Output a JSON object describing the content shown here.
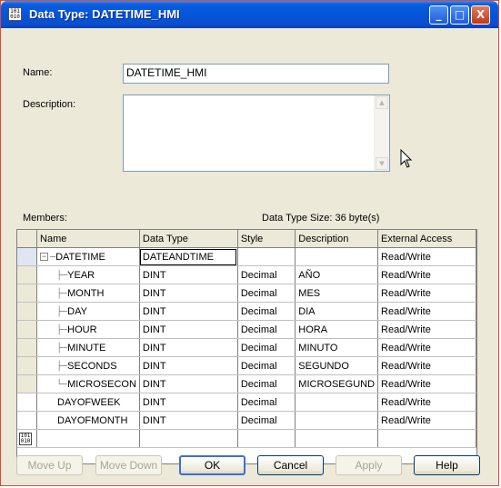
{
  "window": {
    "title": "Data Type:  DATETIME_HMI",
    "icon_text": "101\n010",
    "controls": {
      "minimize": "_",
      "maximize": "□",
      "close": "X"
    }
  },
  "form": {
    "name_label": "Name:",
    "name_value": "DATETIME_HMI",
    "description_label": "Description:",
    "description_value": "",
    "members_label": "Members:",
    "size_text": "Data Type Size: 36 byte(s)"
  },
  "grid": {
    "columns": [
      "Name",
      "Data Type",
      "Style",
      "Description",
      "External Access"
    ],
    "rows": [
      {
        "name": "DATETIME",
        "type": "DATEANDTIME",
        "style": "",
        "description": "",
        "access": "Read/Write"
      },
      {
        "name": "YEAR",
        "type": "DINT",
        "style": "Decimal",
        "description": "AÑO",
        "access": "Read/Write"
      },
      {
        "name": "MONTH",
        "type": "DINT",
        "style": "Decimal",
        "description": "MES",
        "access": "Read/Write"
      },
      {
        "name": "DAY",
        "type": "DINT",
        "style": "Decimal",
        "description": "DIA",
        "access": "Read/Write"
      },
      {
        "name": "HOUR",
        "type": "DINT",
        "style": "Decimal",
        "description": "HORA",
        "access": "Read/Write"
      },
      {
        "name": "MINUTE",
        "type": "DINT",
        "style": "Decimal",
        "description": "MINUTO",
        "access": "Read/Write"
      },
      {
        "name": "SECONDS",
        "type": "DINT",
        "style": "Decimal",
        "description": "SEGUNDO",
        "access": "Read/Write"
      },
      {
        "name": "MICROSECON",
        "type": "DINT",
        "style": "Decimal",
        "description": "MICROSEGUND",
        "access": "Read/Write"
      },
      {
        "name": "DAYOFWEEK",
        "type": "DINT",
        "style": "Decimal",
        "description": "",
        "access": "Read/Write"
      },
      {
        "name": "DAYOFMONTH",
        "type": "DINT",
        "style": "Decimal",
        "description": "",
        "access": "Read/Write"
      }
    ],
    "new_row_icon": "101\n010"
  },
  "buttons": {
    "move_up": "Move Up",
    "move_down": "Move Down",
    "ok": "OK",
    "cancel": "Cancel",
    "apply": "Apply",
    "help": "Help"
  },
  "colors": {
    "titlebar": "#0553d8",
    "face": "#ece9d8",
    "selected_row_header": "#dde6f1"
  }
}
